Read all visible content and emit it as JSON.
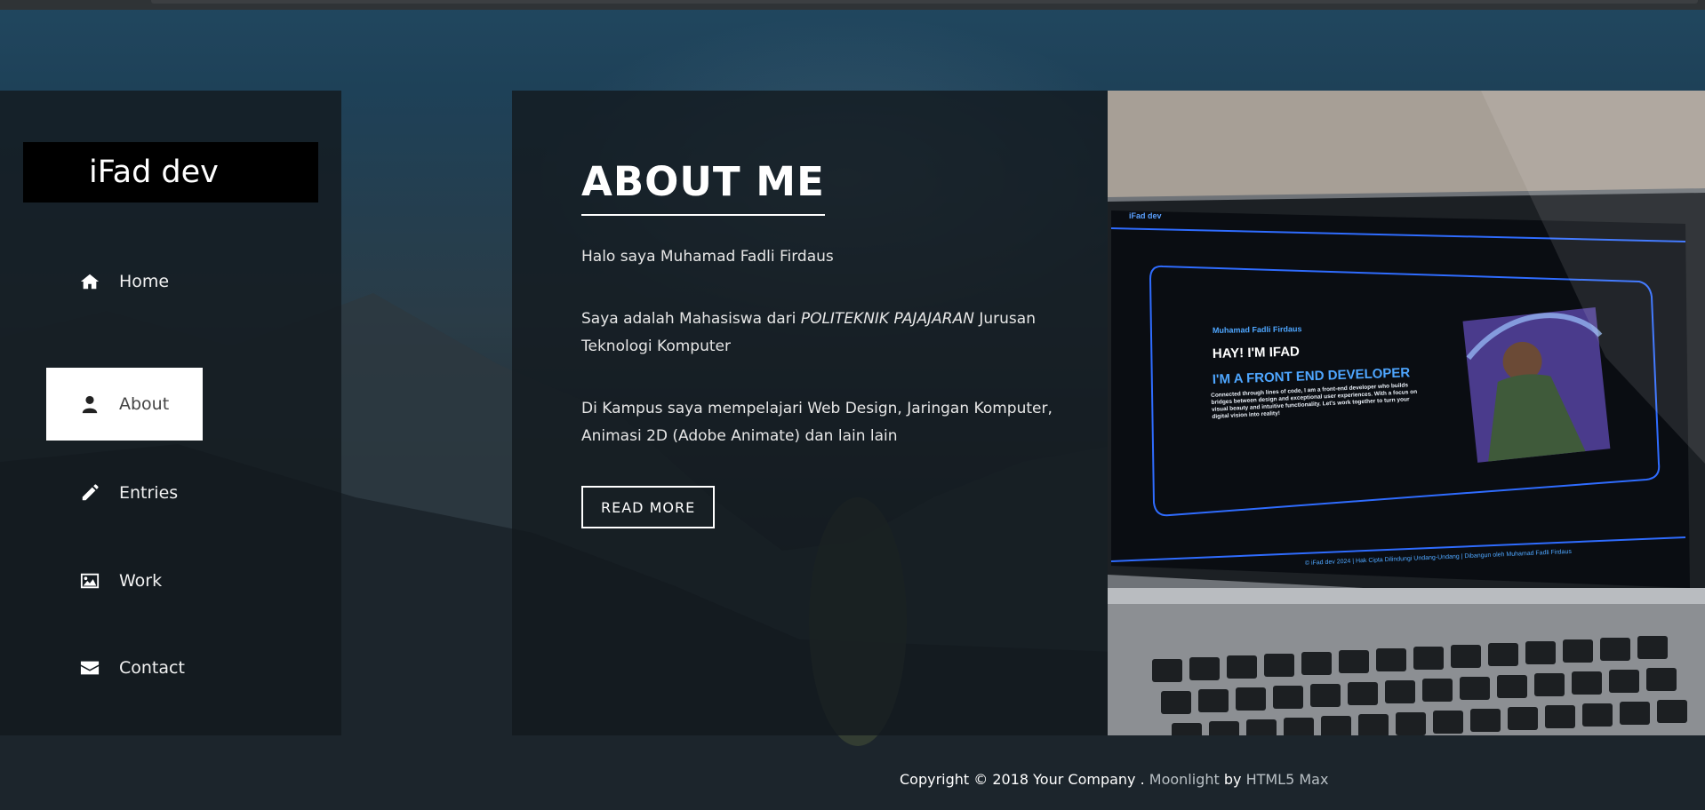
{
  "brand": {
    "name": "iFad dev"
  },
  "nav": {
    "items": [
      {
        "label": "Home",
        "icon": "home-icon"
      },
      {
        "label": "About",
        "icon": "user-icon",
        "active": true
      },
      {
        "label": "Entries",
        "icon": "pencil-icon"
      },
      {
        "label": "Work",
        "icon": "image-icon"
      },
      {
        "label": "Contact",
        "icon": "envelope-icon"
      }
    ]
  },
  "about": {
    "title": "ABOUT ME",
    "intro": "Halo saya Muhamad Fadli Firdaus",
    "p2_before": "Saya adalah Mahasiswa dari ",
    "p2_em": "POLITEKNIK PAJAJARAN",
    "p2_after": " Jurusan Teknologi Komputer",
    "p3": "Di Kampus saya mempelajari Web Design, Jaringan Komputer, Animasi 2D (Adobe Animate) dan lain lain",
    "button": "READ MORE"
  },
  "laptop_screen": {
    "brand": "iFad dev",
    "name": "Muhamad Fadli Firdaus",
    "heading1": "HAY! I'M IFAD",
    "heading2": "I'M A FRONT END DEVELOPER",
    "body": "Connected through lines of code, I am a front-end developer who builds bridges between design and exceptional user experiences. With a focus on visual beauty and intuitive functionality. Let's work together to turn your digital vision into reality!",
    "footer": "© iFad dev 2024 | Hak Cipta Dilindungi Undang-Undang | Dibangun oleh Muhamad Fadli Firdaus"
  },
  "footer": {
    "copyright": "Copyright © 2018 Your Company . ",
    "theme": "Moonlight",
    "by": " by ",
    "author": "HTML5 Max"
  },
  "colors": {
    "panel": "#13191e",
    "accent": "#ffffff",
    "screen_blue": "#2f6cff"
  }
}
